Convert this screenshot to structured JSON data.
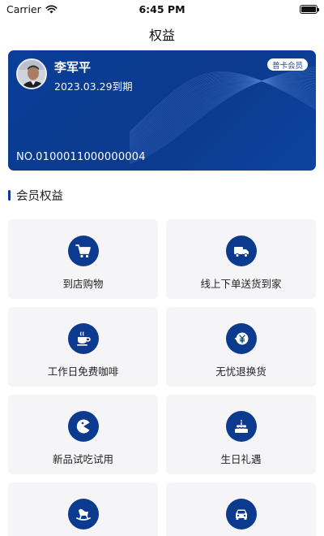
{
  "status_bar": {
    "carrier": "Carrier",
    "time": "6:45 PM"
  },
  "nav": {
    "title": "权益"
  },
  "card": {
    "name": "李军平",
    "expiry": "2023.03.29到期",
    "badge": "普卡会员",
    "number": "NO.0100011000000004"
  },
  "section": {
    "title": "会员权益"
  },
  "benefits": [
    {
      "label": "到店购物",
      "icon": "shopping-cart-icon"
    },
    {
      "label": "线上下单送货到家",
      "icon": "delivery-truck-icon"
    },
    {
      "label": "工作日免费咖啡",
      "icon": "coffee-cup-icon"
    },
    {
      "label": "无忧退换货",
      "icon": "yuan-exchange-icon"
    },
    {
      "label": "新品试吃试用",
      "icon": "pacman-icon"
    },
    {
      "label": "生日礼遇",
      "icon": "birthday-cake-icon"
    },
    {
      "label": "",
      "icon": "rocking-horse-icon"
    },
    {
      "label": "",
      "icon": "car-icon"
    }
  ],
  "colors": {
    "brand": "#0b3a8e",
    "tile_bg": "#f5f5f7"
  }
}
